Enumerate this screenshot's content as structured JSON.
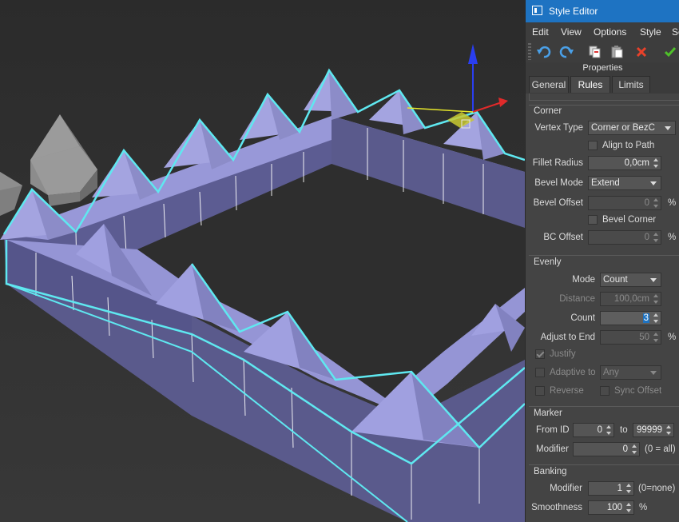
{
  "window": {
    "title": "Style Editor",
    "icon": "window-icon"
  },
  "menu": [
    "Edit",
    "View",
    "Options",
    "Style",
    "Se"
  ],
  "toolbar": {
    "buttons": [
      "undo-icon",
      "redo-icon",
      "copy-icon",
      "paste-icon",
      "delete-icon",
      "apply-icon"
    ],
    "colors": {
      "undo": "#4aa0e8",
      "delete": "#e8412a",
      "apply": "#4fc02a"
    }
  },
  "properties_title": "Properties",
  "tabs": [
    {
      "label": "General",
      "active": false
    },
    {
      "label": "Rules",
      "active": true
    },
    {
      "label": "Limits",
      "active": false
    }
  ],
  "corner": {
    "title": "Corner",
    "vertex_type_label": "Vertex Type",
    "vertex_type_value": "Corner or BezC",
    "align_to_path_label": "Align to Path",
    "align_to_path_checked": false,
    "fillet_radius_label": "Fillet Radius",
    "fillet_radius_value": "0,0cm",
    "bevel_mode_label": "Bevel Mode",
    "bevel_mode_value": "Extend",
    "bevel_offset_label": "Bevel Offset",
    "bevel_offset_value": "0",
    "bevel_offset_unit": "%",
    "bevel_corner_label": "Bevel Corner",
    "bevel_corner_checked": false,
    "bc_offset_label": "BC Offset",
    "bc_offset_value": "0",
    "bc_offset_unit": "%"
  },
  "evenly": {
    "title": "Evenly",
    "mode_label": "Mode",
    "mode_value": "Count",
    "distance_label": "Distance",
    "distance_value": "100,0cm",
    "count_label": "Count",
    "count_value": "3",
    "adjust_to_end_label": "Adjust to End",
    "adjust_to_end_value": "50",
    "adjust_to_end_unit": "%",
    "justify_label": "Justify",
    "justify_checked": true,
    "adaptive_to_label": "Adaptive to",
    "adaptive_to_value": "Any",
    "reverse_label": "Reverse",
    "sync_offset_label": "Sync Offset"
  },
  "marker": {
    "title": "Marker",
    "from_id_label": "From ID",
    "from_id_value": "0",
    "to_label": "to",
    "to_value": "99999",
    "modifier_label": "Modifier",
    "modifier_value": "0",
    "modifier_hint": "(0 = all)"
  },
  "banking": {
    "title": "Banking",
    "modifier_label": "Modifier",
    "modifier_value": "1",
    "modifier_hint": "(0=none)",
    "smoothness_label": "Smoothness",
    "smoothness_value": "100",
    "smoothness_unit": "%"
  },
  "viewport": {
    "wall_color_top": "#9a9ad8",
    "wall_color_side": "#5a5a8a",
    "selection_color": "#5fe8f0",
    "background": "#303030"
  }
}
